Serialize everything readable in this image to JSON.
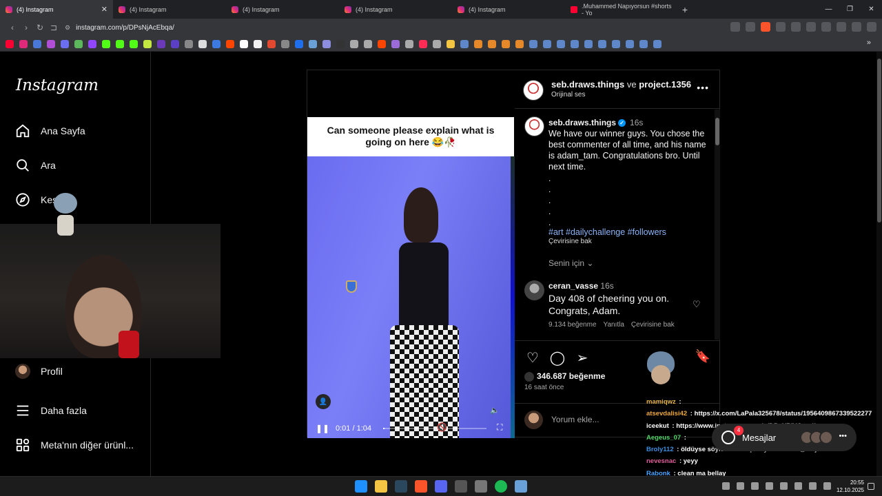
{
  "browser": {
    "tabs": [
      {
        "label": "(4) Instagram",
        "type": "instagram",
        "active": true
      },
      {
        "label": "(4) Instagram",
        "type": "instagram"
      },
      {
        "label": "(4) Instagram",
        "type": "instagram"
      },
      {
        "label": "(4) Instagram",
        "type": "instagram"
      },
      {
        "label": "(4) Instagram",
        "type": "instagram"
      },
      {
        "label": ".Muhammed Napıyorsun #shorts - Yo",
        "type": "youtube"
      }
    ],
    "url": "instagram.com/p/DPsNjAcEbqa/",
    "window_controls": [
      "—",
      "❐",
      "✕"
    ]
  },
  "sidebar": {
    "logo": "Instagram",
    "items": [
      {
        "label": "Ana Sayfa",
        "icon": "home-icon"
      },
      {
        "label": "Ara",
        "icon": "search-icon"
      },
      {
        "label": "Keşfet",
        "icon": "compass-icon"
      },
      {
        "label": "Profil",
        "icon": "avatar"
      },
      {
        "label": "Daha fazla",
        "icon": "menu-icon"
      },
      {
        "label": "Meta'nın diğer ürünl...",
        "icon": "grid-icon"
      }
    ]
  },
  "post": {
    "video_caption": "Can someone please explain what is going on here 😂🥀",
    "video_time": "0:01 / 1:04",
    "progress": 0.016,
    "header": {
      "user1": "seb.draws.things",
      "conj": "ve",
      "user2": "project.1356",
      "audio": "Orijinal ses"
    },
    "caption": {
      "user": "seb.draws.things",
      "time": "16s",
      "text": "We have our winner guys. You chose the best commenter of all time, and his name is adam_tam. Congratulations bro. Until next time.",
      "dots": [
        ".",
        ".",
        ".",
        ".",
        "."
      ],
      "tags": "#art #dailychallenge #followers",
      "translate": "Çevirisine bak"
    },
    "for_you": "Senin için",
    "comment": {
      "user": "ceran_vasse",
      "time": "16s",
      "text": "Day 408 of cheering you on. Congrats, Adam.",
      "likes": "9.134 beğenme",
      "reply": "Yanıtla",
      "translate": "Çevirisine bak"
    },
    "likes": "346.687 beğenme",
    "ago": "16 saat önce",
    "add_comment_placeholder": "Yorum ekle..."
  },
  "chat": [
    {
      "user": "mamiqwz",
      "msg": "",
      "color": "#e8b64c"
    },
    {
      "user": "atsevdalisi42",
      "msg": "https://x.com/LaPala325678/status/1956409867339522277",
      "color": "#f0a83a"
    },
    {
      "user": "iceekut",
      "msg": "https://www.instagram.com/p/DPqYPjVCund/",
      "color": "#ffffff"
    },
    {
      "user": "Aegeus_07",
      "msg": "",
      "color": "#53d86a"
    },
    {
      "user": "Broly112",
      "msg": "öldüyse söylesene ırkçı mıydı kendisi @kaijiri",
      "color": "#3b8fe0"
    },
    {
      "user": "nevesnac",
      "msg": "yeyy",
      "color": "#e05d9a"
    },
    {
      "user": "Rabonk",
      "msg": "clean ma bellay",
      "color": "#4aa3ff"
    }
  ],
  "messages_pill": {
    "label": "Mesajlar",
    "badge": "4"
  },
  "taskbar": {
    "time": "20:55",
    "date": "12.10.2025"
  },
  "colors": {
    "accent_blue": "#0095f6",
    "hashtag": "#8ab4f8",
    "like_red": "#ff3040"
  }
}
